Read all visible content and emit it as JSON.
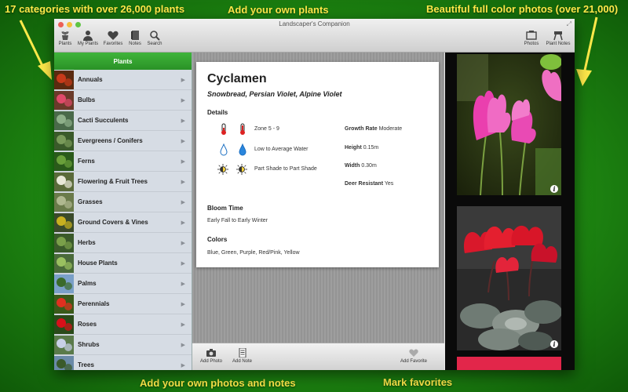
{
  "captions": {
    "top_left": "17 categories with over 26,000 plants",
    "top_center": "Add your own plants",
    "top_right": "Beautiful full color photos (over 21,000)",
    "bottom_left": "Add your own photos and notes",
    "bottom_center": "Mark favorites"
  },
  "window": {
    "title": "Landscaper's Companion"
  },
  "toolbar": {
    "plants": "Plants",
    "my_plants": "My Plants",
    "favorites": "Favorites",
    "notes": "Notes",
    "search": "Search",
    "photos": "Photos",
    "plant_notes": "Plant Notes"
  },
  "sidebar": {
    "header": "Plants",
    "items": [
      {
        "label": "Annuals"
      },
      {
        "label": "Bulbs"
      },
      {
        "label": "Cacti Succulents"
      },
      {
        "label": "Evergreens / Conifers"
      },
      {
        "label": "Ferns"
      },
      {
        "label": "Flowering & Fruit Trees"
      },
      {
        "label": "Grasses"
      },
      {
        "label": "Ground Covers & Vines"
      },
      {
        "label": "Herbs"
      },
      {
        "label": "House Plants"
      },
      {
        "label": "Palms"
      },
      {
        "label": "Perennials"
      },
      {
        "label": "Roses"
      },
      {
        "label": "Shrubs"
      },
      {
        "label": "Trees"
      }
    ],
    "chevron": "▶"
  },
  "plant": {
    "name": "Cyclamen",
    "synonyms": "Snowbread, Persian Violet, Alpine Violet",
    "details_label": "Details",
    "zone": "Zone 5 - 9",
    "water": "Low to Average Water",
    "light": "Part Shade to Part Shade",
    "growth_label": "Growth Rate",
    "growth_value": "Moderate",
    "height_label": "Height",
    "height_value": "0.15m",
    "width_label": "Width",
    "width_value": "0.30m",
    "deer_label": "Deer Resistant",
    "deer_value": "Yes",
    "bloom_label": "Bloom Time",
    "bloom_value": "Early Fall to Early Winter",
    "colors_label": "Colors",
    "colors_value": "Blue, Green, Purple, Red/Pink, Yellow"
  },
  "bottombar": {
    "add_photo": "Add Photo",
    "add_note": "Add Note",
    "add_favorite": "Add Favorite"
  },
  "photo_info": "i",
  "colors": {
    "caption": "#ffe94a",
    "sidebar_header": "#2f9e2b",
    "background_green": "#1f8a12"
  }
}
